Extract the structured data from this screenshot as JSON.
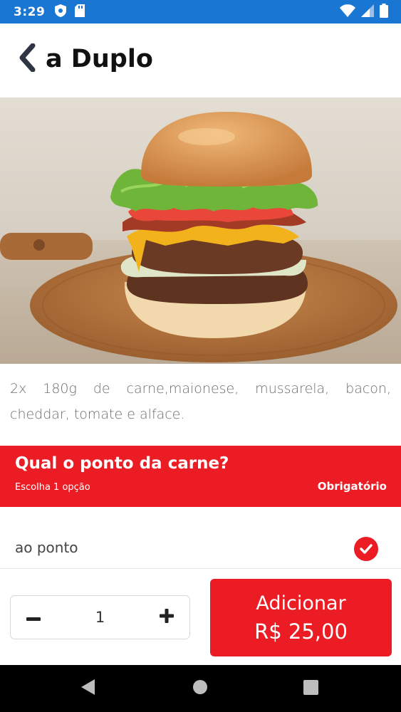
{
  "status_bar": {
    "time": "3:29",
    "icons": [
      "shield-icon",
      "sd-card-icon",
      "wifi-icon",
      "signal-icon",
      "battery-icon"
    ]
  },
  "header": {
    "title": "a Duplo",
    "back_icon": "chevron-left-icon"
  },
  "product": {
    "image": "burger-photo",
    "description": "2x 180g de carne,maionese, mussarela, bacon, cheddar, tomate e alface."
  },
  "option_group": {
    "title": "Qual o ponto da carne?",
    "subtitle": "Escolha 1 opção",
    "required_label": "Obrigatório",
    "selected_option": "ao ponto"
  },
  "order": {
    "quantity": "1",
    "add_label": "Adicionar",
    "price": "R$ 25,00"
  },
  "colors": {
    "status_bar": "#1976d2",
    "accent": "#ec1c24",
    "text": "#111111"
  }
}
